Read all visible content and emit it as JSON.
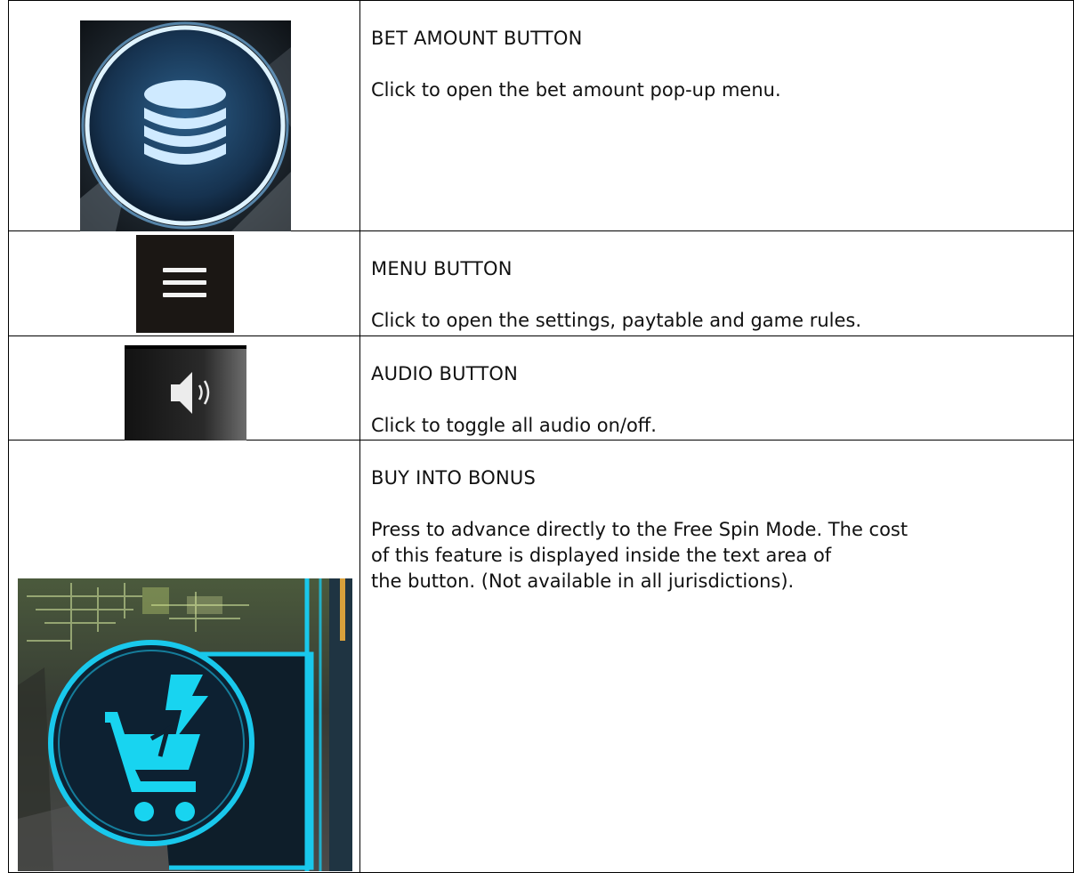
{
  "rows": [
    {
      "icon": "coin-stack-icon",
      "title": "BET AMOUNT BUTTON",
      "description": "Click to open the bet amount pop-up menu."
    },
    {
      "icon": "hamburger-menu-icon",
      "title": "MENU BUTTON",
      "description": "Click to open the settings, paytable and game rules."
    },
    {
      "icon": "speaker-icon",
      "title": "AUDIO BUTTON",
      "description": "Click to toggle all audio on/off."
    },
    {
      "icon": "shopping-cart-lightning-icon",
      "title": "BUY INTO BONUS",
      "description_lines": [
        "Press to advance directly to the Free Spin Mode. The cost",
        "of this feature is displayed inside the text area of",
        "the button. (Not available in all jurisdictions)."
      ]
    }
  ],
  "colors": {
    "coin_glow": "#bfe6ff",
    "cart_cyan": "#18d4f0",
    "dark_panel": "#1b1714"
  }
}
